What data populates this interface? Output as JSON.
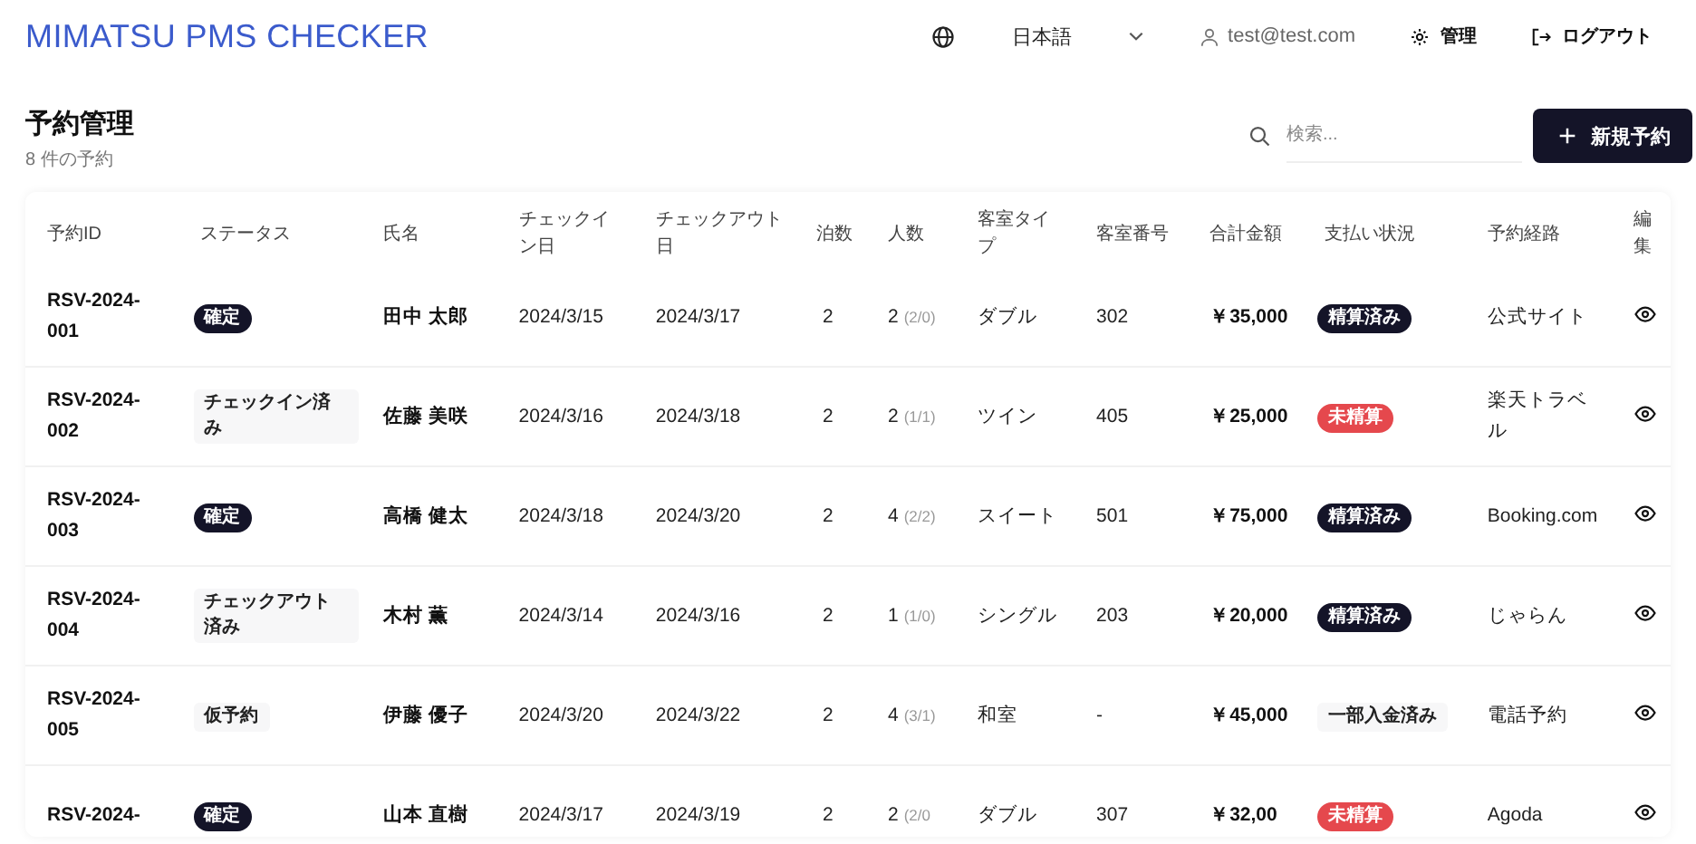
{
  "header": {
    "title": "MIMATSU PMS CHECKER",
    "language": "日本語",
    "user": "test@test.com",
    "admin": "管理",
    "logout": "ログアウト"
  },
  "page": {
    "title": "予約管理",
    "count": "8 件の予約",
    "search_placeholder": "検索...",
    "new_button": "新規予約"
  },
  "table": {
    "columns": [
      "予約ID",
      "ステータス",
      "氏名",
      "チェックイン日",
      "チェックアウト日",
      "泊数",
      "人数",
      "客室タイプ",
      "客室番号",
      "合計金額",
      "支払い状況",
      "予約経路",
      "編集"
    ],
    "rows": [
      {
        "id": "RSV-2024-001",
        "status": {
          "label": "確定",
          "kind": "dark"
        },
        "name": "田中 太郎",
        "checkin": "2024/3/15",
        "checkout": "2024/3/17",
        "nights": "2",
        "guests": "2",
        "guest_breakdown": "(2/0)",
        "room_type": "ダブル",
        "room_no": "302",
        "total": "￥35,000",
        "payment": {
          "label": "精算済み",
          "kind": "dark"
        },
        "channel": "公式サイト"
      },
      {
        "id": "RSV-2024-002",
        "status": {
          "label": "チェックイン済み",
          "kind": "light"
        },
        "name": "佐藤 美咲",
        "checkin": "2024/3/16",
        "checkout": "2024/3/18",
        "nights": "2",
        "guests": "2",
        "guest_breakdown": "(1/1)",
        "room_type": "ツイン",
        "room_no": "405",
        "total": "￥25,000",
        "payment": {
          "label": "未精算",
          "kind": "red"
        },
        "channel": "楽天トラベル"
      },
      {
        "id": "RSV-2024-003",
        "status": {
          "label": "確定",
          "kind": "dark"
        },
        "name": "高橋 健太",
        "checkin": "2024/3/18",
        "checkout": "2024/3/20",
        "nights": "2",
        "guests": "4",
        "guest_breakdown": "(2/2)",
        "room_type": "スイート",
        "room_no": "501",
        "total": "￥75,000",
        "payment": {
          "label": "精算済み",
          "kind": "dark"
        },
        "channel": "Booking.com"
      },
      {
        "id": "RSV-2024-004",
        "status": {
          "label": "チェックアウト済み",
          "kind": "light"
        },
        "name": "木村 薫",
        "checkin": "2024/3/14",
        "checkout": "2024/3/16",
        "nights": "2",
        "guests": "1",
        "guest_breakdown": "(1/0)",
        "room_type": "シングル",
        "room_no": "203",
        "total": "￥20,000",
        "payment": {
          "label": "精算済み",
          "kind": "dark"
        },
        "channel": "じゃらん"
      },
      {
        "id": "RSV-2024-005",
        "status": {
          "label": "仮予約",
          "kind": "light"
        },
        "name": "伊藤 優子",
        "checkin": "2024/3/20",
        "checkout": "2024/3/22",
        "nights": "2",
        "guests": "4",
        "guest_breakdown": "(3/1)",
        "room_type": "和室",
        "room_no": "-",
        "total": "￥45,000",
        "payment": {
          "label": "一部入金済み",
          "kind": "light"
        },
        "channel": "電話予約"
      },
      {
        "id": "RSV-2024-",
        "status": {
          "label": "確定",
          "kind": "dark"
        },
        "name": "山本 直樹",
        "checkin": "2024/3/17",
        "checkout": "2024/3/19",
        "nights": "2",
        "guests": "2",
        "guest_breakdown": "(2/0",
        "room_type": "ダブル",
        "room_no": "307",
        "total": "￥32,00",
        "payment": {
          "label": "未精算",
          "kind": "red"
        },
        "channel": "Agoda"
      }
    ]
  }
}
